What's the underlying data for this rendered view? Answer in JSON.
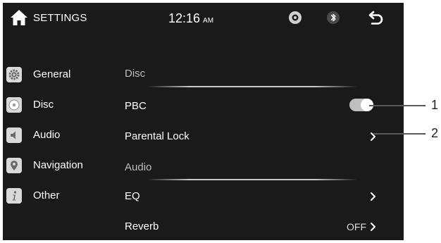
{
  "status_bar": {
    "title": "SETTINGS",
    "time": "12:16",
    "ampm": "AM"
  },
  "sidebar": {
    "items": [
      {
        "label": "General",
        "icon": "gear-icon"
      },
      {
        "label": "Disc",
        "icon": "disc-icon"
      },
      {
        "label": "Audio",
        "icon": "speaker-icon"
      },
      {
        "label": "Navigation",
        "icon": "location-pin-icon"
      },
      {
        "label": "Other",
        "icon": "info-icon"
      }
    ]
  },
  "sections": {
    "disc": {
      "header": "Disc",
      "rows": {
        "pbc": {
          "label": "PBC",
          "toggle_on": true
        },
        "parental_lock": {
          "label": "Parental Lock"
        }
      }
    },
    "audio": {
      "header": "Audio",
      "rows": {
        "eq": {
          "label": "EQ"
        },
        "reverb": {
          "label": "Reverb",
          "value": "OFF"
        }
      }
    }
  },
  "callouts": [
    "1",
    "2"
  ],
  "colors": {
    "screen_bg": "#1a1a1a",
    "text": "#ffffff",
    "section_header": "#bdbdbd",
    "icon_bg": "#d9d9d9",
    "toggle_track": "#bfbfbf"
  }
}
